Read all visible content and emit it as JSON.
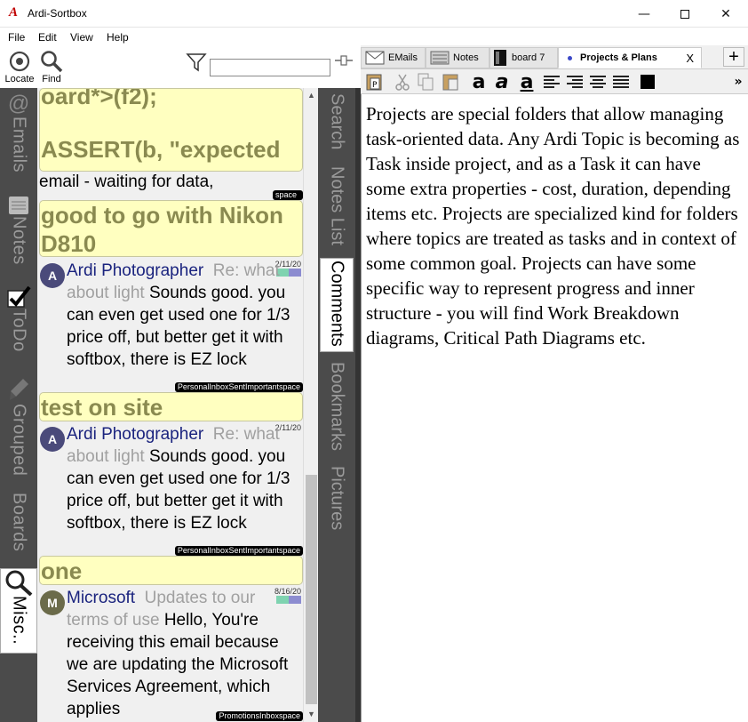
{
  "window": {
    "title": "Ardi-Sortbox",
    "app_icon": "A",
    "minimize": "—",
    "close": "✕"
  },
  "menu": [
    "File",
    "Edit",
    "View",
    "Help"
  ],
  "toolbar": {
    "locate": "Locate",
    "find": "Find",
    "filter_value": ""
  },
  "left_rail": [
    "Emails",
    "Notes",
    "ToDo",
    "Grouped",
    "Boards",
    "Misc.."
  ],
  "right_rail": [
    "Search",
    "Notes List",
    "Comments",
    "Bookmarks",
    "Pictures"
  ],
  "list": {
    "group1_lines": [
      "oard*>(f2);",
      "",
      "ASSERT(b, \"expected"
    ],
    "plain_line": "email - waiting for data,",
    "plain_tag": "space",
    "group2": "good to go with Nikon D810",
    "item1": {
      "avatar": "A",
      "from": "Ardi Photographer",
      "subject": "Re: what about light",
      "body": "Sounds good. you can even get used one for 1/3 price off, but better get it with softbox, there is EZ lock",
      "date": "2/11/20",
      "tags": "PersonalInboxSentImportantspace"
    },
    "group3": "test on site",
    "item2": {
      "avatar": "A",
      "from": "Ardi Photographer",
      "subject": "Re: what about light",
      "body": "Sounds good. you can even get used one for 1/3 price off, but better get it with softbox, there is EZ lock",
      "date": "2/11/20",
      "tags": "PersonalInboxSentImportantspace"
    },
    "group4": "one",
    "item3": {
      "avatar": "M",
      "from": "Microsoft",
      "subject": "Updates to our terms of use",
      "body": "Hello, You're receiving this email because we are updating the Microsoft Services Agreement, which applies",
      "date": "8/16/20",
      "tags": "PromotionsInboxspace"
    }
  },
  "tabs": [
    {
      "label": "EMails",
      "icon": "mail-icon"
    },
    {
      "label": "Notes",
      "icon": "notes-icon"
    },
    {
      "label": "board 7",
      "icon": "board-icon"
    },
    {
      "label": "Projects & Plans",
      "icon": "dot",
      "close": "X"
    }
  ],
  "add_tab": "+",
  "format_more": "»",
  "document": {
    "text": "Projects are special folders that allow managing task-oriented data. Any Ardi Topic is becoming as Task inside project, and as a Task it can have some extra properties - cost, duration, depending items etc. Projects are specialized kind for folders where topics are treated as tasks and in context of some common goal. Projects can have some specific way to represent progress and inner structure - you will find Work Breakdown diagrams, Critical Path Diagrams etc."
  },
  "colors": {
    "rail": "#4b4b4b",
    "group_bg": "#ffffc0",
    "group_text": "#8a8a50",
    "sender": "#1a237e",
    "avatar_a": "#4a4a7a",
    "avatar_m": "#6b6b4a"
  }
}
